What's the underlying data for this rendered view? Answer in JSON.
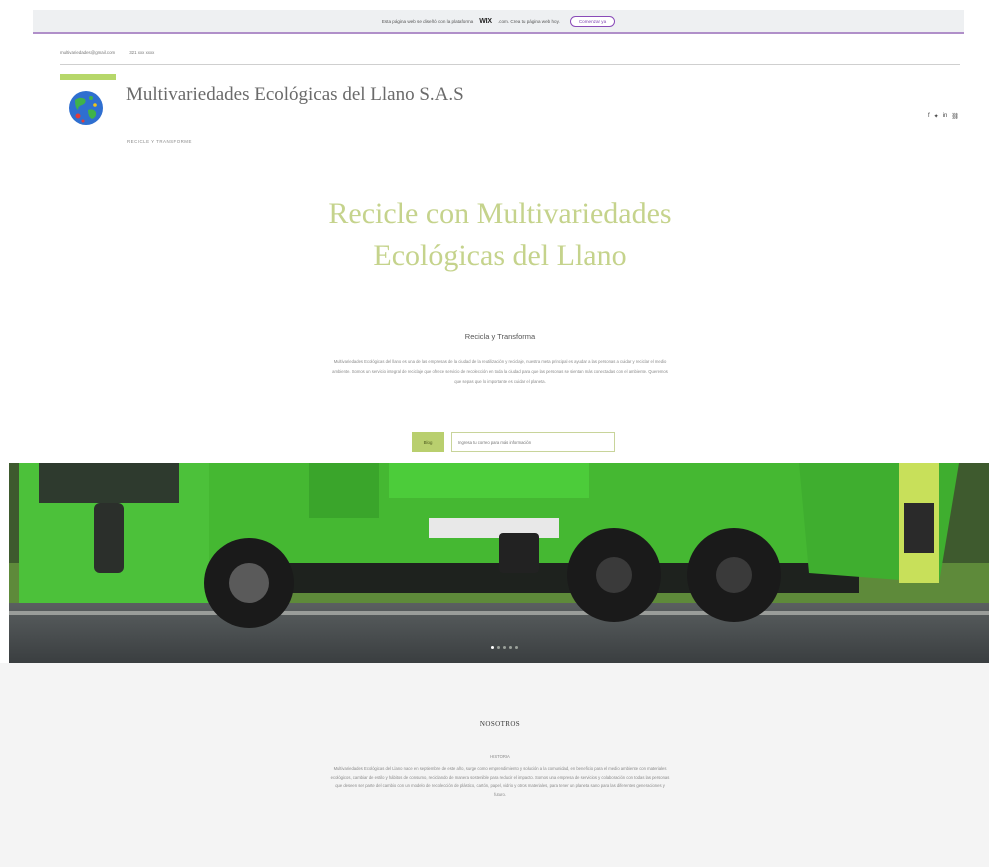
{
  "wix_banner": {
    "text": "Esta página web se diseñó con la plataforma",
    "brand": "WIX",
    "text_after": ".com. Crea tu página web hoy.",
    "cta": "Comenzar ya"
  },
  "topbar": {
    "email": "multivariedades@gmail.com",
    "phone": "321 xxx xxxx"
  },
  "header": {
    "title": "Multivariedades Ecológicas del Llano S.A.S",
    "tagline": "RECICLE Y TRANSFORME",
    "social_icons": [
      "facebook-icon",
      "twitter-icon",
      "linkedin-icon",
      "link-icon"
    ]
  },
  "hero": {
    "title": "Recicle con Multivariedades Ecológicas del Llano",
    "subtitle": "Recicla y Transforma",
    "paragraph": "Multivariedades Ecológicas del llano es una de las empresas de la ciudad de la reutilización y reciclaje, nuestra meta principal es ayudar a las personas a cuidar y reciclar el medio ambiente. Somos un servicio integral de reciclaje que ofrece servicio de recolección en toda la ciudad para que las personas se sientan más conectadas con el ambiente. Queremos que sepas que lo importante es cuidar el planeta.",
    "button": "Blog",
    "search_placeholder": "Ingresa tu correo para más información"
  },
  "carousel": {
    "slides": 5,
    "active": 1
  },
  "about": {
    "title": "NOSOTROS",
    "subtitle": "HISTORIA",
    "paragraph": "Multivariedades Ecológicas del Llano nace en septiembre de este año, surge como emprendimiento y solución a la comunidad, en beneficio para el medio ambiente con materiales ecológicos, cambiar de estilo y hábitos de consumo, reciclando de manera sostenible para reducir el impacto. Somos una empresa de servicios y colaboración con todas las personas que deseen ser parte del cambio con un modelo de recolección de plástico, cartón, papel, vidrio y otros materiales, para tener un planeta sano para las diferentes generaciones y futuro."
  },
  "colors": {
    "accent": "#c5d38c",
    "button": "#b9cf6e",
    "banner_border": "#b08fc9"
  }
}
